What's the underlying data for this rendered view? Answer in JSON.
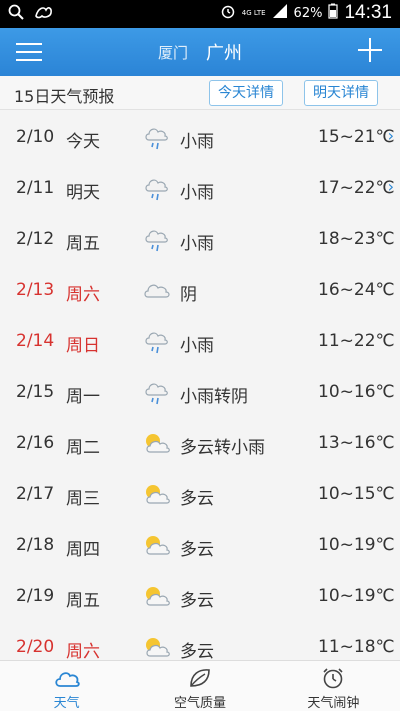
{
  "status_bar": {
    "network": "4G LTE",
    "battery": "62%",
    "time": "14:31"
  },
  "header": {
    "cities": [
      "厦门",
      "广州"
    ],
    "active_city": "广州"
  },
  "subheader": {
    "title": "15日天气预报",
    "today_button": "今天详情",
    "tomorrow_button": "明天详情"
  },
  "forecast": [
    {
      "date": "2/10",
      "day": "今天",
      "condition": "小雨",
      "temp": "15~21℃",
      "icon": "light-rain-icon",
      "weekend": false,
      "chevron": true
    },
    {
      "date": "2/11",
      "day": "明天",
      "condition": "小雨",
      "temp": "17~22℃",
      "icon": "light-rain-icon",
      "weekend": false,
      "chevron": true
    },
    {
      "date": "2/12",
      "day": "周五",
      "condition": "小雨",
      "temp": "18~23℃",
      "icon": "light-rain-icon",
      "weekend": false,
      "chevron": false
    },
    {
      "date": "2/13",
      "day": "周六",
      "condition": "阴",
      "temp": "16~24℃",
      "icon": "overcast-icon",
      "weekend": true,
      "chevron": false
    },
    {
      "date": "2/14",
      "day": "周日",
      "condition": "小雨",
      "temp": "11~22℃",
      "icon": "light-rain-icon",
      "weekend": true,
      "chevron": false
    },
    {
      "date": "2/15",
      "day": "周一",
      "condition": "小雨转阴",
      "temp": "10~16℃",
      "icon": "light-rain-icon",
      "weekend": false,
      "chevron": false
    },
    {
      "date": "2/16",
      "day": "周二",
      "condition": "多云转小雨",
      "temp": "13~16℃",
      "icon": "partly-cloudy-icon",
      "weekend": false,
      "chevron": false
    },
    {
      "date": "2/17",
      "day": "周三",
      "condition": "多云",
      "temp": "10~15℃",
      "icon": "partly-cloudy-icon",
      "weekend": false,
      "chevron": false
    },
    {
      "date": "2/18",
      "day": "周四",
      "condition": "多云",
      "temp": "10~19℃",
      "icon": "partly-cloudy-icon",
      "weekend": false,
      "chevron": false
    },
    {
      "date": "2/19",
      "day": "周五",
      "condition": "多云",
      "temp": "10~19℃",
      "icon": "partly-cloudy-icon",
      "weekend": false,
      "chevron": false
    },
    {
      "date": "2/20",
      "day": "周六",
      "condition": "多云",
      "temp": "11~18℃",
      "icon": "partly-cloudy-icon",
      "weekend": true,
      "chevron": false
    }
  ],
  "tabs": [
    {
      "label": "天气",
      "icon": "cloud-icon",
      "active": true
    },
    {
      "label": "空气质量",
      "icon": "leaf-icon",
      "active": false
    },
    {
      "label": "天气闹钟",
      "icon": "alarm-clock-icon",
      "active": false
    }
  ],
  "colors": {
    "accent": "#2a86d3",
    "header": "#3d9ae6",
    "weekend": "#d7322f"
  }
}
